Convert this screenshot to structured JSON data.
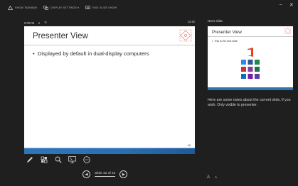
{
  "topbar": {
    "items": [
      {
        "label": "SHOW TASKBAR",
        "icon": "taskbar-icon"
      },
      {
        "label": "DISPLAY SETTINGS ▾",
        "icon": "display-settings-icon"
      },
      {
        "label": "END SLIDE SHOW",
        "icon": "end-slideshow-icon"
      }
    ],
    "window_controls": [
      "–",
      "✕"
    ]
  },
  "presenter": {
    "timer": "0:00:08",
    "pause_icon": "pause-icon",
    "restart_icon": "restart-icon",
    "clock": "13:42"
  },
  "current_slide": {
    "title": "Presenter View",
    "bullet": "Displayed by default in dual-display computers",
    "number": "42",
    "accent": "#2e75b6"
  },
  "tools": [
    "pen-icon",
    "see-all-slides-icon",
    "zoom-icon",
    "black-screen-icon",
    "more-options-icon"
  ],
  "nav": {
    "prev_icon": "◀",
    "label": "Slide 42 of 43",
    "next_icon": "▶"
  },
  "next_slide": {
    "header": "Next slide",
    "title": "Presenter View",
    "bullet": "This is the next slide"
  },
  "notes": "Here are some notes about the current slide, if you wish. Only visible to presenter.",
  "font_controls": [
    "A",
    "A"
  ]
}
